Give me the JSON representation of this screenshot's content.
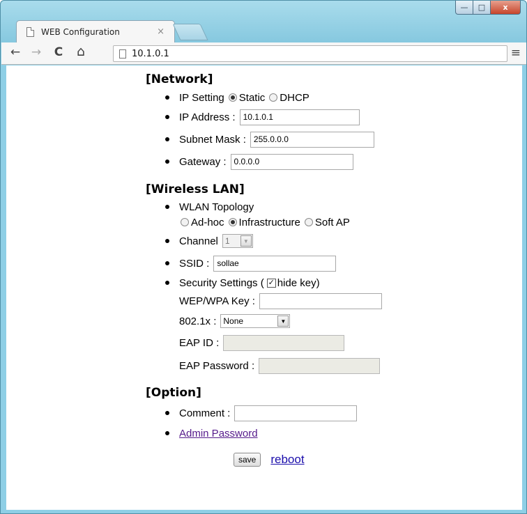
{
  "browser": {
    "tab_title": "WEB Configuration",
    "tab_close": "×",
    "address": "10.1.0.1",
    "back_icon": "←",
    "forward_icon": "→",
    "reload_icon": "C",
    "home_icon": "⌂",
    "menu_icon": "≡",
    "window_min": "—",
    "window_max": "□",
    "window_close": "x"
  },
  "network": {
    "heading": "[Network]",
    "ip_setting_label": "IP Setting",
    "opt_static": "Static",
    "opt_dhcp": "DHCP",
    "ip_address_label": "IP Address :",
    "ip_address_value": "10.1.0.1",
    "subnet_label": "Subnet Mask :",
    "subnet_value": "255.0.0.0",
    "gateway_label": "Gateway :",
    "gateway_value": "0.0.0.0"
  },
  "wireless": {
    "heading": "[Wireless LAN]",
    "topology_label": "WLAN Topology",
    "opt_adhoc": "Ad-hoc",
    "opt_infra": "Infrastructure",
    "opt_softap": "Soft AP",
    "channel_label": "Channel",
    "channel_value": "1",
    "ssid_label": "SSID :",
    "ssid_value": "sollae",
    "security_label_pre": "Security Settings (",
    "hide_key_label": "hide key)",
    "wep_label": "WEP/WPA Key :",
    "wep_value": "",
    "dot1x_label": "802.1x :",
    "dot1x_value": "None",
    "eap_id_label": "EAP ID :",
    "eap_pw_label": "EAP Password :"
  },
  "option": {
    "heading": "[Option]",
    "comment_label": "Comment :",
    "comment_value": "",
    "admin_link": "Admin Password"
  },
  "actions": {
    "save_label": "save",
    "reboot_label": "reboot"
  }
}
